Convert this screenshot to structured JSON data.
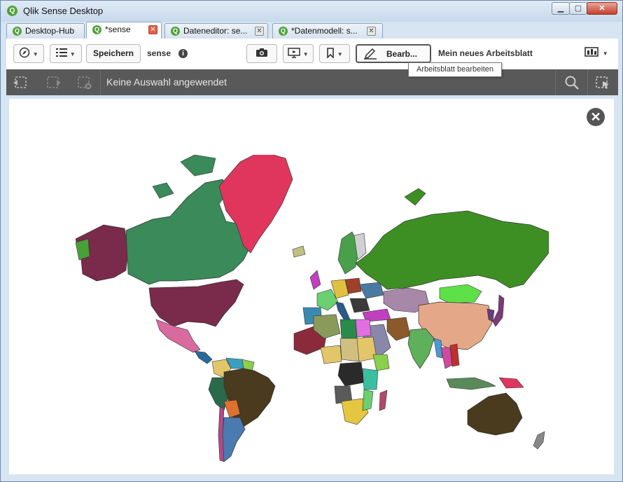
{
  "window": {
    "title": "Qlik Sense Desktop",
    "min_label": "▁",
    "max_label": "▢",
    "close_label": "✕"
  },
  "tabs": [
    {
      "label": "Desktop-Hub"
    },
    {
      "label": "*sense"
    },
    {
      "label": "Dateneditor: se..."
    },
    {
      "label": "*Datenmodell: s..."
    }
  ],
  "toolbar": {
    "save_label": "Speichern",
    "app_name": "sense",
    "edit_label": "Bearb...",
    "sheet_title": "Mein neues Arbeitsblatt",
    "tooltip": "Arbeitsblatt bearbeiten"
  },
  "selection_bar": {
    "text": "Keine Auswahl angewendet"
  },
  "icons": {
    "app": "qlik-logo-icon",
    "compass": "compass-icon",
    "list": "list-icon",
    "info": "info-icon",
    "camera": "camera-icon",
    "present": "presentation-icon",
    "bookmark": "bookmark-icon",
    "pencil": "pencil-icon",
    "sheets": "sheets-icon",
    "close": "close-circle-icon"
  },
  "colors": {
    "selection_bar": "#595959",
    "tab_close_active": "#e0603e",
    "north_america": "#3a8a5a",
    "usa": "#7a2a4a",
    "greenland": "#e0365e",
    "russia": "#3d8f23",
    "china": "#e4a888",
    "brazil": "#4a3a1e",
    "australia": "#4a3a1e",
    "india": "#5fb05a"
  }
}
